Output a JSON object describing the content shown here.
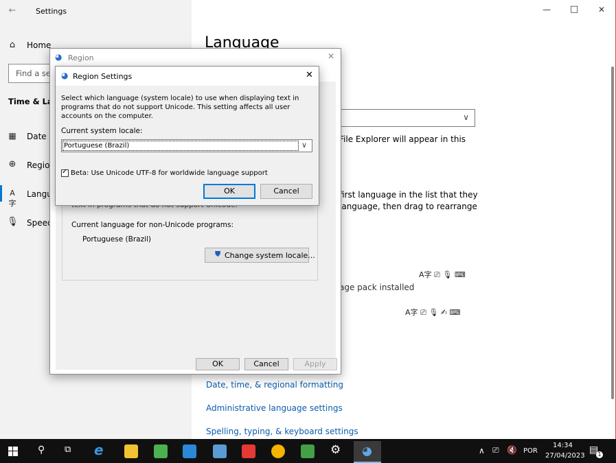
{
  "settings": {
    "title": "Settings",
    "home_label": "Home",
    "search_placeholder": "Find a set",
    "section_label": "Time & Lan",
    "nav": [
      {
        "label": "Date &"
      },
      {
        "label": "Region"
      },
      {
        "label": "Langu"
      },
      {
        "label": "Speec"
      }
    ],
    "page_title": "Language",
    "main_texts": {
      "explorer": "File Explorer will appear in this",
      "first_lang_1": "first language in the list that they",
      "first_lang_2": "language, then drag to rearrange",
      "lang_pack": "age pack installed"
    },
    "links": {
      "date_time": "Date, time, & regional formatting",
      "admin": "Administrative language settings",
      "spelling": "Spelling, typing, & keyboard settings"
    },
    "buttons": {
      "minimize": "—",
      "maximize": "□",
      "close": "✕"
    }
  },
  "region_dialog": {
    "title": "Region",
    "partial_text": "text in programs that do not support Unicode.",
    "current_label": "Current language for non-Unicode programs:",
    "current_value": "Portuguese (Brazil)",
    "change_button": "Change system locale...",
    "ok": "OK",
    "cancel": "Cancel",
    "apply": "Apply"
  },
  "region_settings_dialog": {
    "title": "Region Settings",
    "description": "Select which language (system locale) to use when displaying text in programs that do not support Unicode. This setting affects all user accounts on the computer.",
    "locale_label": "Current system locale:",
    "locale_value": "Portuguese (Brazil)",
    "beta_label": "Beta: Use Unicode UTF-8 for worldwide language support",
    "ok": "OK",
    "cancel": "Cancel"
  },
  "taskbar": {
    "language": "POR",
    "time": "14:34",
    "date": "27/04/2023",
    "notification_count": "1"
  },
  "colors": {
    "accent": "#0078d7",
    "link": "#0b5cad",
    "taskbar": "#101010"
  }
}
